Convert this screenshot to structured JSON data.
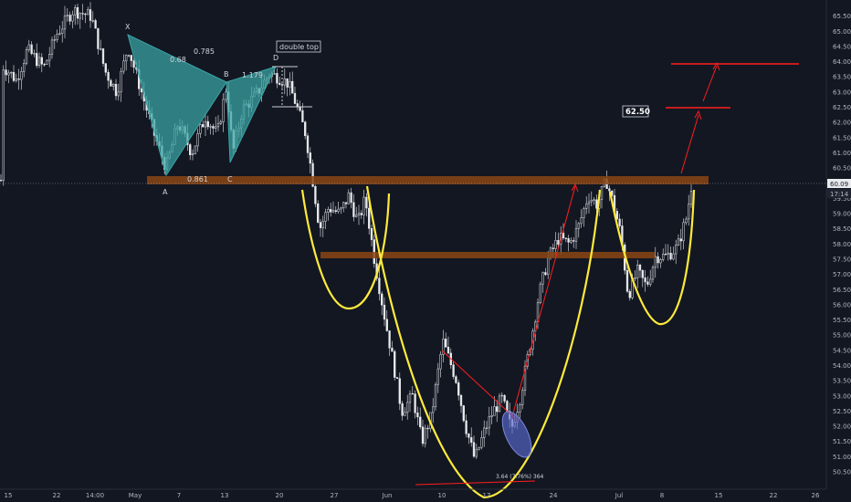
{
  "chart_data": {
    "type": "candlestick",
    "y_axis": {
      "ticks": [
        "65.50",
        "65.00",
        "64.50",
        "64.00",
        "63.50",
        "63.00",
        "62.50",
        "62.00",
        "61.50",
        "61.00",
        "60.50",
        "60.00",
        "59.50",
        "59.00",
        "58.50",
        "58.00",
        "57.50",
        "57.00",
        "56.50",
        "56.00",
        "55.50",
        "55.00",
        "54.50",
        "54.00",
        "53.50",
        "53.00",
        "52.50",
        "52.00",
        "51.50",
        "51.00",
        "50.50"
      ],
      "ylim": [
        50.35,
        65.85
      ]
    },
    "x_axis": {
      "ticks": [
        "15",
        "22",
        "14:00",
        "May",
        "7",
        "13",
        "20",
        "27",
        "Jun",
        "10",
        "17",
        "24",
        "Jul",
        "8",
        "15",
        "22",
        "26"
      ]
    },
    "last_price": "60.09",
    "countdown": "17:14",
    "harmonic_pattern": {
      "points": [
        {
          "label": "X",
          "value": 64.75
        },
        {
          "label": "A",
          "value": 60.35
        },
        {
          "label": "B",
          "value": 63.4
        },
        {
          "label": "C",
          "value": 60.75
        },
        {
          "label": "D",
          "value": 63.72
        }
      ],
      "ratios": [
        "0.68",
        "0.785",
        "1.179",
        "0.861"
      ]
    },
    "annotations": {
      "double_top": "double top",
      "target": "62.50",
      "measurement": "3.64 (7.76%) 364"
    },
    "zones": [
      {
        "name": "resistance",
        "low": 60.02,
        "high": 60.38
      },
      {
        "name": "neckline",
        "low": 57.8,
        "high": 57.95
      }
    ],
    "target_lines": [
      62.55,
      63.92
    ],
    "key_prices": {
      "low": 50.75,
      "recent_high": 60.15
    }
  },
  "colors": {
    "background": "#131722",
    "candles": "#e8eaed",
    "pattern": "#3aa6a6",
    "zone": "#8b4513",
    "trend": "#ff1e1e",
    "curve": "#ffeb3b",
    "ellipse": "#5a6ad1"
  }
}
